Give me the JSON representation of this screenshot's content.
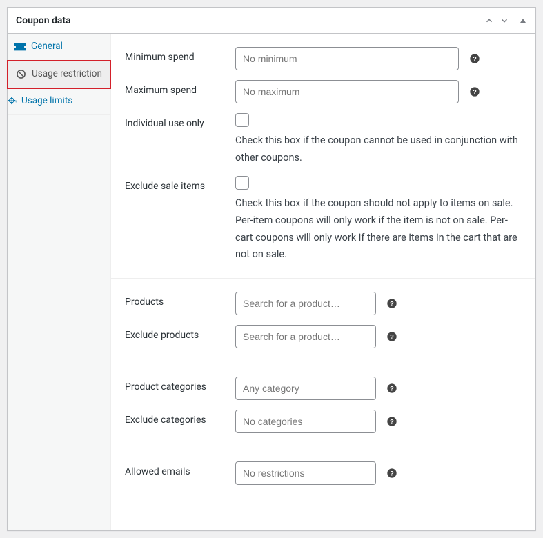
{
  "header": {
    "title": "Coupon data"
  },
  "tabs": {
    "general": "General",
    "usage_restriction": "Usage restriction",
    "usage_limits": "Usage limits"
  },
  "fields": {
    "min_spend": {
      "label": "Minimum spend",
      "placeholder": "No minimum"
    },
    "max_spend": {
      "label": "Maximum spend",
      "placeholder": "No maximum"
    },
    "individual_use": {
      "label": "Individual use only",
      "desc": "Check this box if the coupon cannot be used in conjunction with other coupons."
    },
    "exclude_sale": {
      "label": "Exclude sale items",
      "desc": "Check this box if the coupon should not apply to items on sale. Per-item coupons will only work if the item is not on sale. Per-cart coupons will only work if there are items in the cart that are not on sale."
    },
    "products": {
      "label": "Products",
      "placeholder": "Search for a product…"
    },
    "exclude_products": {
      "label": "Exclude products",
      "placeholder": "Search for a product…"
    },
    "product_cats": {
      "label": "Product categories",
      "placeholder": "Any category"
    },
    "exclude_cats": {
      "label": "Exclude categories",
      "placeholder": "No categories"
    },
    "allowed_emails": {
      "label": "Allowed emails",
      "placeholder": "No restrictions"
    }
  }
}
